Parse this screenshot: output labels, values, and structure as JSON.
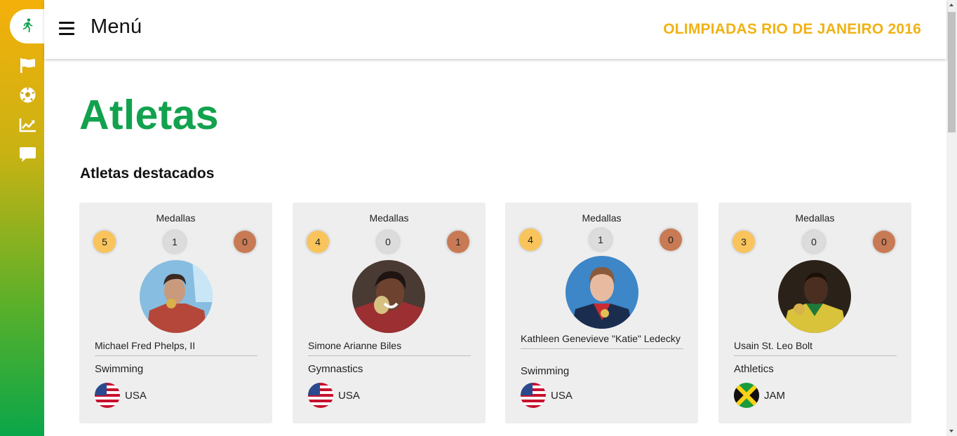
{
  "header": {
    "menu_label": "Menú",
    "brand": "OLIMPIADAS RIO DE JANEIRO 2016"
  },
  "sidebar": {
    "items": [
      {
        "icon": "runner-icon",
        "active": true
      },
      {
        "icon": "flag-icon"
      },
      {
        "icon": "soccer-ball-icon"
      },
      {
        "icon": "line-chart-icon"
      },
      {
        "icon": "comment-icon"
      }
    ]
  },
  "page": {
    "title": "Atletas",
    "section_title": "Atletas destacados"
  },
  "colors": {
    "gold": "#f9c45c",
    "silver": "#dcdcdc",
    "bronze": "#c87a54",
    "brand": "#f0b215",
    "title_green": "#12a24e"
  },
  "athletes": [
    {
      "medals_label": "Medallas",
      "gold": "5",
      "silver": "1",
      "bronze": "0",
      "name": "Michael Fred Phelps, II",
      "sport": "Swimming",
      "country": "USA",
      "flag_icon": "usa-flag-icon"
    },
    {
      "medals_label": "Medallas",
      "gold": "4",
      "silver": "0",
      "bronze": "1",
      "name": "Simone Arianne Biles",
      "sport": "Gymnastics",
      "country": "USA",
      "flag_icon": "usa-flag-icon"
    },
    {
      "medals_label": "Medallas",
      "gold": "4",
      "silver": "1",
      "bronze": "0",
      "name": "Kathleen Genevieve \"Katie\" Ledecky",
      "sport": "Swimming",
      "country": "USA",
      "flag_icon": "usa-flag-icon"
    },
    {
      "medals_label": "Medallas",
      "gold": "3",
      "silver": "0",
      "bronze": "0",
      "name": "Usain St. Leo Bolt",
      "sport": "Athletics",
      "country": "JAM",
      "flag_icon": "jamaica-flag-icon"
    }
  ]
}
